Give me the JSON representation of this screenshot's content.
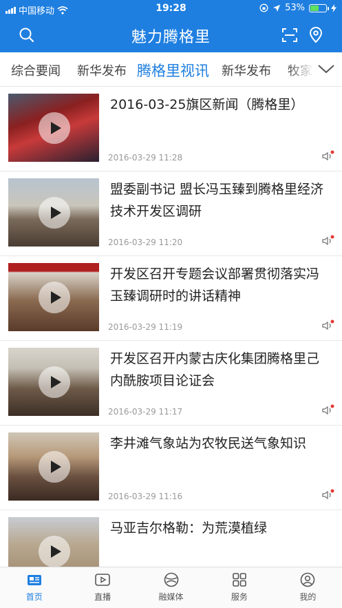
{
  "status": {
    "carrier": "中国移动",
    "time": "19:28",
    "battery": "53%",
    "battery_level": 0.53
  },
  "header": {
    "title": "魅力腾格里"
  },
  "tabs": [
    "综合要闻",
    "新华发布",
    "腾格里视讯",
    "新华发布",
    "牧家"
  ],
  "active_tab": 2,
  "news": [
    {
      "title": "2016-03-25旗区新闻（腾格里）",
      "date": "2016-03-29 11:28"
    },
    {
      "title": "盟委副书记 盟长冯玉臻到腾格里经济技术开发区调研",
      "date": "2016-03-29 11:20"
    },
    {
      "title": "开发区召开专题会议部署贯彻落实冯玉臻调研时的讲话精神",
      "date": "2016-03-29 11:19"
    },
    {
      "title": "开发区召开内蒙古庆化集团腾格里己内酰胺项目论证会",
      "date": "2016-03-29 11:17"
    },
    {
      "title": "李井滩气象站为农牧民送气象知识",
      "date": "2016-03-29 11:16"
    },
    {
      "title": "马亚吉尔格勒：为荒漠植绿",
      "date": ""
    }
  ],
  "bottom_nav": [
    "首页",
    "直播",
    "融媒体",
    "服务",
    "我的"
  ],
  "colors": {
    "brand": "#1f7fe0",
    "alert_dot": "#e53935"
  }
}
